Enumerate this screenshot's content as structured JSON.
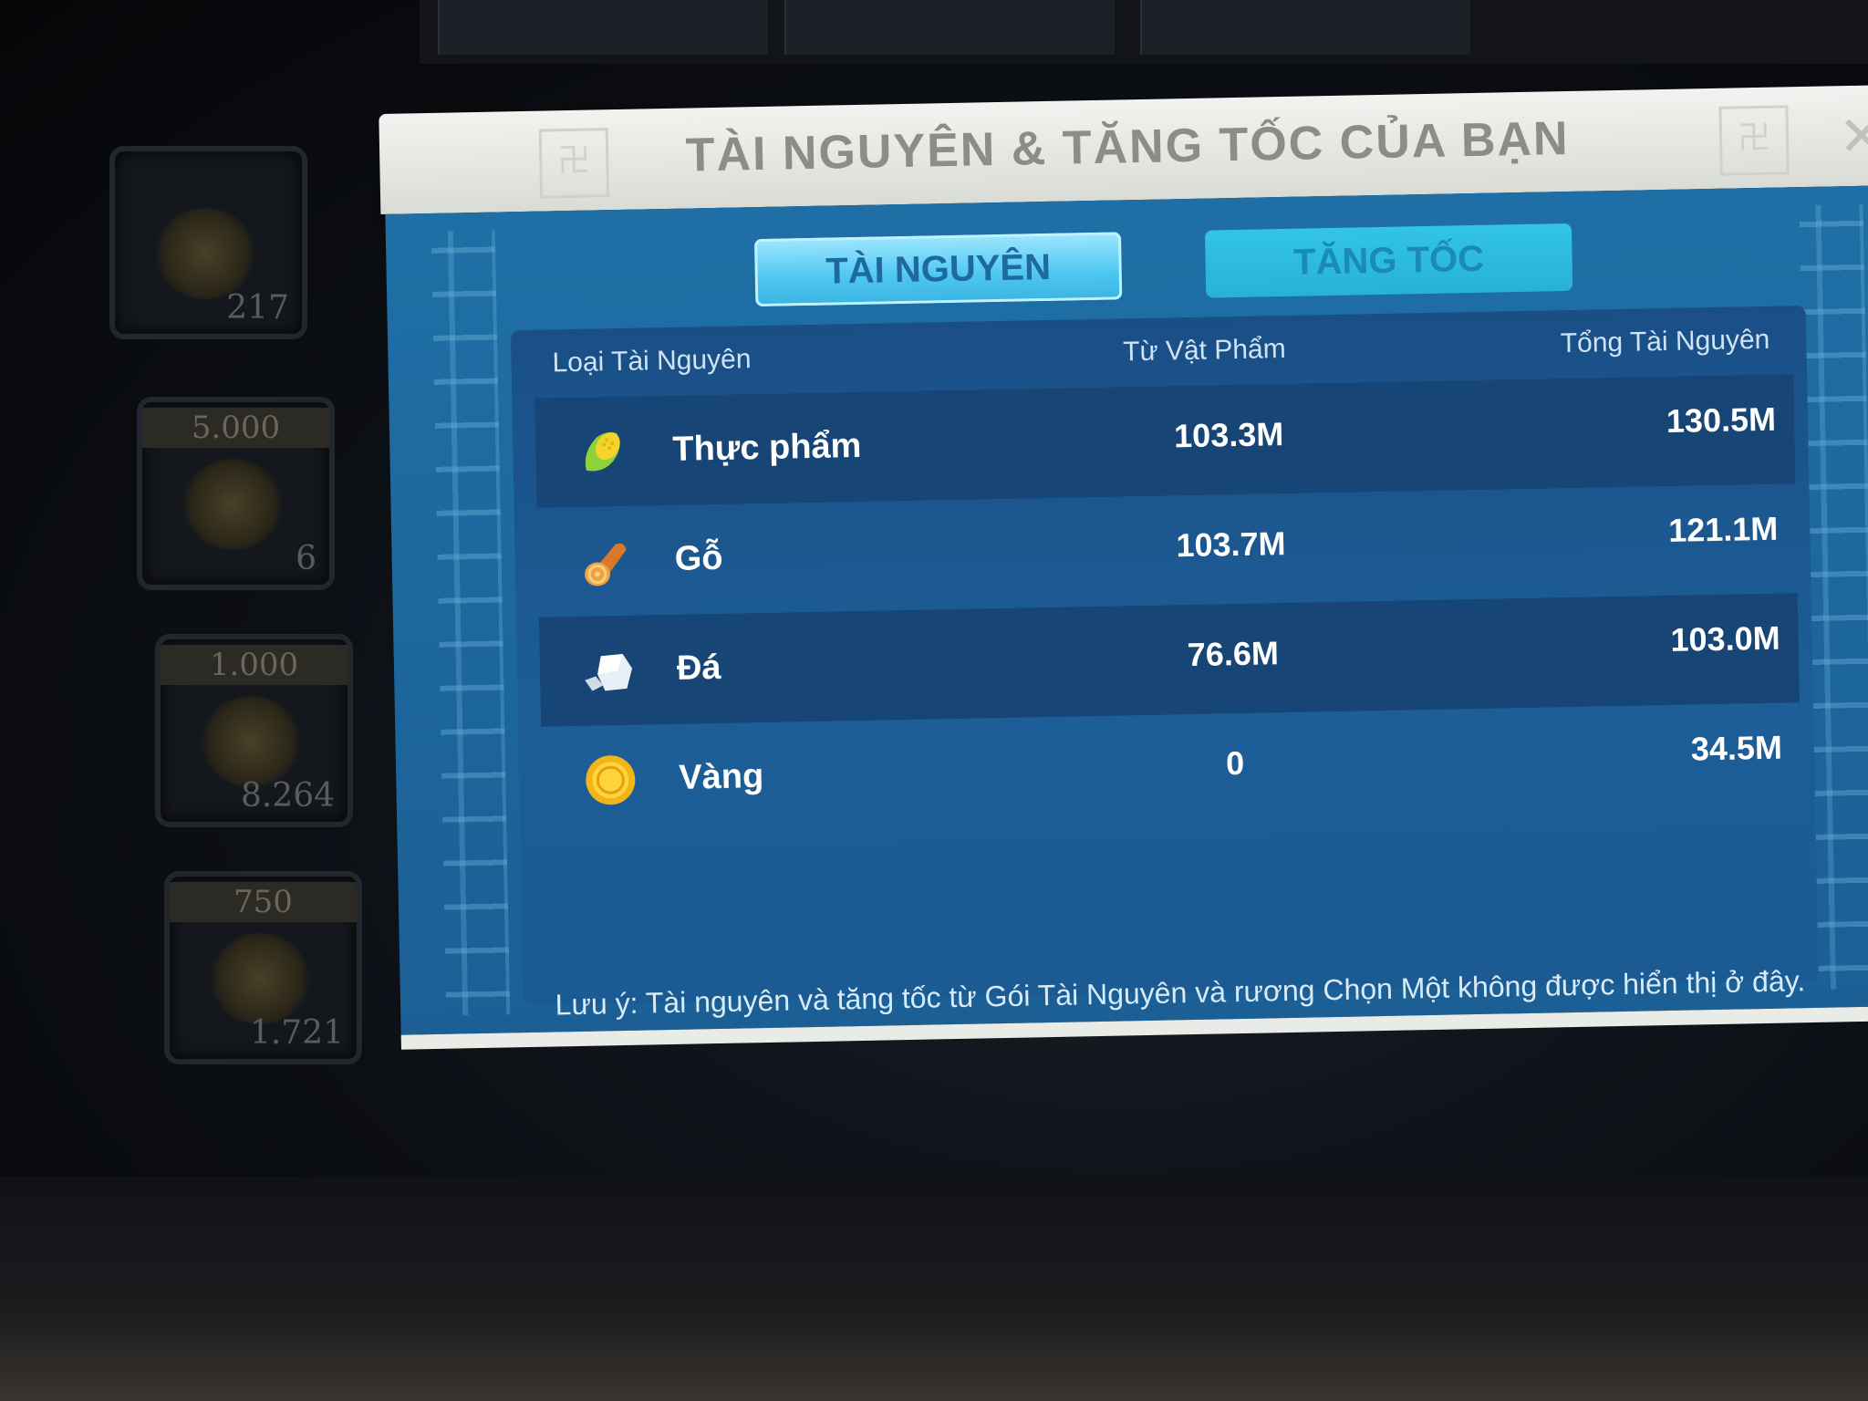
{
  "dialog": {
    "title": "TÀI NGUYÊN & TĂNG TỐC CỦA BẠN",
    "tabs": [
      {
        "label": "TÀI NGUYÊN",
        "active": true
      },
      {
        "label": "TĂNG TỐC",
        "active": false
      }
    ],
    "columns": {
      "type": "Loại Tài Nguyên",
      "from_items": "Từ Vật Phẩm",
      "total": "Tổng Tài Nguyên"
    },
    "rows": [
      {
        "icon": "corn-icon",
        "name": "Thực phẩm",
        "from_items": "103.3M",
        "total": "130.5M"
      },
      {
        "icon": "wood-log-icon",
        "name": "Gỗ",
        "from_items": "103.7M",
        "total": "121.1M"
      },
      {
        "icon": "stone-icon",
        "name": "Đá",
        "from_items": "76.6M",
        "total": "103.0M"
      },
      {
        "icon": "gold-coin-icon",
        "name": "Vàng",
        "from_items": "0",
        "total": "34.5M"
      }
    ],
    "note": "Lưu ý: Tài nguyên và tăng tốc từ Gói Tài Nguyên và rương Chọn Một không được hiển thị ở đây."
  },
  "background_items": [
    {
      "cost": "",
      "count": "217"
    },
    {
      "cost": "5.000",
      "count": "6"
    },
    {
      "cost": "1.000",
      "count": "8.264"
    },
    {
      "cost": "750",
      "count": "1.721"
    }
  ],
  "colors": {
    "dialog_blue": "#1f6fa6",
    "row_dark": "#174576",
    "tab_active": "#4dc7f0",
    "tab_inactive": "#27b1d9"
  }
}
